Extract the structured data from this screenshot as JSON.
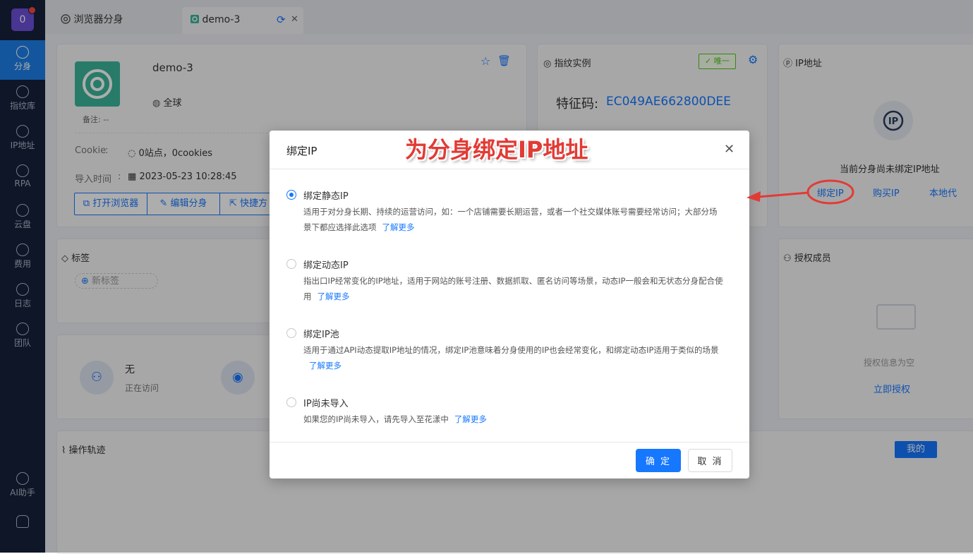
{
  "sidebar": {
    "avatar": "0",
    "items": [
      {
        "label": "分身"
      },
      {
        "label": "指纹库"
      },
      {
        "label": "IP地址"
      },
      {
        "label": "RPA"
      },
      {
        "label": "云盘"
      },
      {
        "label": "费用"
      },
      {
        "label": "日志"
      },
      {
        "label": "团队"
      }
    ],
    "ai_label": "AI助手"
  },
  "tabs": [
    {
      "label": "浏览器分身"
    },
    {
      "label": "demo-3"
    }
  ],
  "profile": {
    "name": "demo-3",
    "region": "全球",
    "note": "备注: --",
    "cookie_label": "Cookie",
    "cookie_value": "0站点，0cookies",
    "import_label": "导入时间",
    "import_value": "2023-05-23 10:28:45",
    "buttons": [
      "打开浏览器",
      "编辑分身",
      "快捷方"
    ]
  },
  "fingerprint": {
    "title": "指纹实例",
    "badge": "唯一",
    "code_label": "特征码:",
    "code_value": "EC049AE662800DEE"
  },
  "ip_card": {
    "title": "IP地址",
    "empty_text": "当前分身尚未绑定IP地址",
    "actions": [
      "绑定IP",
      "购买IP",
      "本地代"
    ]
  },
  "tags_card": {
    "title": "标签",
    "new_tag": "新标签"
  },
  "visit_card": {
    "value": "无",
    "label": "正在访问"
  },
  "members_card": {
    "title": "授权成员",
    "empty": "授权信息为空",
    "action": "立即授权"
  },
  "ops_card": {
    "title": "操作轨迹",
    "mine": "我的"
  },
  "dialog": {
    "title": "绑定IP",
    "options": [
      {
        "title": "绑定静态IP",
        "desc": "适用于对分身长期、持续的运营访问，如：一个店铺需要长期运营，或者一个社交媒体账号需要经常访问；大部分场景下都应选择此选项",
        "link": "了解更多",
        "selected": true
      },
      {
        "title": "绑定动态IP",
        "desc": "指出口IP经常变化的IP地址，适用于网站的账号注册、数据抓取、匿名访问等场景，动态IP一般会和无状态分身配合使用",
        "link": "了解更多",
        "selected": false
      },
      {
        "title": "绑定IP池",
        "desc": "适用于通过API动态提取IP地址的情况，绑定IP池意味着分身使用的IP也会经常变化，和绑定动态IP适用于类似的场景",
        "link": "了解更多",
        "selected": false
      },
      {
        "title": "IP尚未导入",
        "desc": "如果您的IP尚未导入，请先导入至花漾中",
        "link": "了解更多",
        "selected": false
      }
    ],
    "ok": "确 定",
    "cancel": "取 消"
  },
  "annotation": "为分身绑定IP地址",
  "colors": {
    "primary": "#1677ff",
    "sidebar": "#16213a",
    "annotation": "#e23b35",
    "brand_teal": "#3bb59a"
  }
}
